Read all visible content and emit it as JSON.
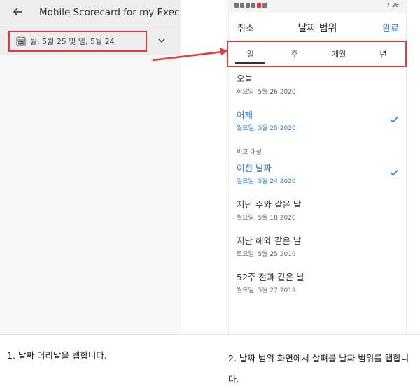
{
  "left": {
    "title": "Mobile Scorecard for my Exec",
    "date_header": "월, 5월 25 및 일, 5월 24"
  },
  "right": {
    "status_time": "7:26",
    "cancel": "취소",
    "title": "날짜 범위",
    "done": "완료",
    "tabs": [
      "일",
      "주",
      "개월",
      "년"
    ],
    "items": [
      {
        "title": "오늘",
        "date": "화요일, 5월 26 2020",
        "selected": false
      },
      {
        "title": "어제",
        "date": "월요일, 5월 25 2020",
        "selected": true
      }
    ],
    "section_label": "비교 대상",
    "compare_items": [
      {
        "title": "이전 날짜",
        "date": "일요일, 5월 24 2020",
        "selected": true
      },
      {
        "title": "지난 주와 같은 날",
        "date": "월요일, 5월 18 2020",
        "selected": false
      },
      {
        "title": "지난 해와 같은 날",
        "date": "토요일, 5월 25 2019",
        "selected": false
      },
      {
        "title": "52주 전과 같은 날",
        "date": "월요일, 5월 27 2019",
        "selected": false
      }
    ]
  },
  "captions": {
    "step1": "1. 날짜 머리말을 탭합니다.",
    "step2": "2. 날짜 범위 화면에서 살펴볼 날짜 범위를 탭합니다."
  },
  "colors": {
    "highlight": "#e8383d",
    "accent": "#2680eb"
  }
}
